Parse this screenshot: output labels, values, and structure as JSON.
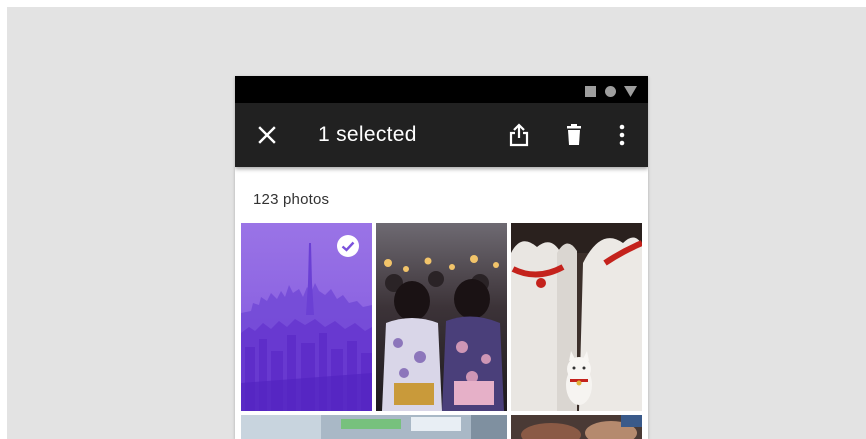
{
  "app_bar": {
    "selection_title": "1 selected",
    "close_icon": "close-icon",
    "actions": [
      "share-icon",
      "delete-icon",
      "more-vert-icon"
    ]
  },
  "status_bar": {
    "icons": [
      "square-icon",
      "circle-icon",
      "triangle-icon"
    ]
  },
  "gallery": {
    "photo_count_label": "123 photos",
    "photos": [
      {
        "id": "city-skyline",
        "selected": true
      },
      {
        "id": "festival-crowd",
        "selected": false
      },
      {
        "id": "lucky-cats",
        "selected": false
      },
      {
        "id": "street-blur",
        "selected": false
      },
      {
        "id": "food-closeup",
        "selected": false
      }
    ]
  },
  "colors": {
    "selection_overlay": "#6a3fd9",
    "app_bar": "#212121",
    "status_bar": "#000000",
    "canvas": "#e3e3e3"
  }
}
